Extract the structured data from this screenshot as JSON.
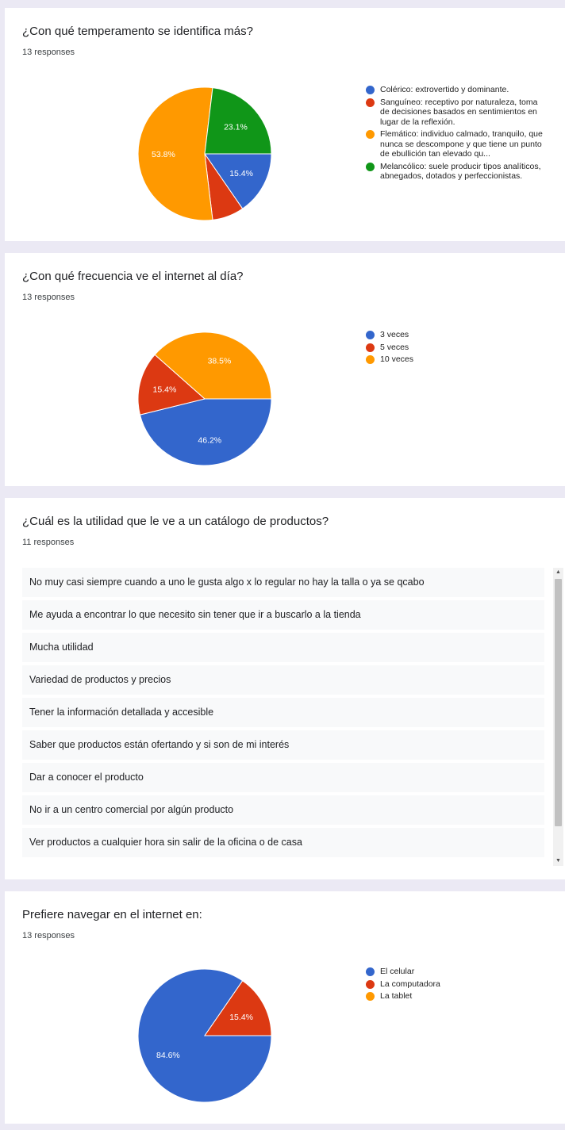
{
  "colors": {
    "blue": "#3366cc",
    "red": "#dc3912",
    "orange": "#ff9900",
    "green": "#109618"
  },
  "cards": [
    {
      "title": "¿Con qué temperamento se identifica más?",
      "responses": "13 responses",
      "chart_data": {
        "type": "pie",
        "categories": [
          "Colérico: extrovertido y dominante.",
          "Sanguíneo: receptivo por naturaleza, toma de decisiones basados en sentimientos en lugar de la reflexión.",
          "Flemático: individuo calmado, tranquilo, que nunca se descompone y que tiene un punto de ebullición tan elevado qu...",
          "Melancólico: suele producir tipos analíticos, abnegados, dotados y perfeccionistas."
        ],
        "values": [
          15.4,
          7.7,
          53.8,
          23.1
        ],
        "value_labels": [
          "15.4%",
          "",
          "53.8%",
          "23.1%"
        ],
        "colors": [
          "#3366cc",
          "#dc3912",
          "#ff9900",
          "#109618"
        ],
        "legend": "right"
      }
    },
    {
      "title": "¿Con qué frecuencia ve el internet al día?",
      "responses": "13 responses",
      "chart_data": {
        "type": "pie",
        "categories": [
          "3 veces",
          "5 veces",
          "10 veces"
        ],
        "values": [
          46.2,
          15.4,
          38.5
        ],
        "value_labels": [
          "46.2%",
          "15.4%",
          "38.5%"
        ],
        "colors": [
          "#3366cc",
          "#dc3912",
          "#ff9900"
        ],
        "legend": "right"
      }
    },
    {
      "title": "¿Cuál es la utilidad que le ve a un catálogo de productos?",
      "responses": "11 responses",
      "answers": [
        "No muy casi siempre cuando a uno le gusta algo x lo regular no hay la talla o ya se qcabo",
        "Me ayuda a encontrar lo que necesito sin tener que ir a buscarlo a la tienda",
        "Mucha utilidad",
        "Variedad de productos y precios",
        "Tener la información detallada y accesible",
        "Saber que productos están ofertando y si son de mi interés",
        "Dar a conocer el producto",
        "No ir a un centro comercial por algún producto",
        "Ver productos a cualquier hora sin salir de la oficina o de casa"
      ]
    },
    {
      "title": "Prefiere navegar en el internet en:",
      "responses": "13 responses",
      "chart_data": {
        "type": "pie",
        "categories": [
          "El celular",
          "La computadora",
          "La tablet"
        ],
        "values": [
          84.6,
          15.4,
          0
        ],
        "value_labels": [
          "84.6%",
          "15.4%",
          ""
        ],
        "colors": [
          "#3366cc",
          "#dc3912",
          "#ff9900"
        ],
        "legend": "right"
      }
    }
  ]
}
